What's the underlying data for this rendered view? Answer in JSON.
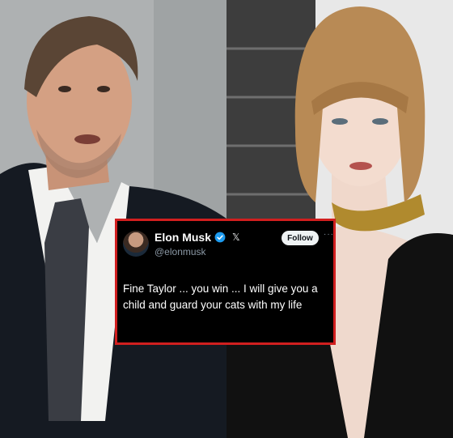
{
  "tweet": {
    "display_name": "Elon Musk",
    "handle": "@elonmusk",
    "follow_label": "Follow",
    "more_label": "···",
    "x_logo": "𝕏",
    "text": "Fine Taylor ... you win ... I will give you a child and guard your cats with my life"
  },
  "colors": {
    "card_background": "#000000",
    "card_border": "#d11f1f",
    "verified": "#1d9bf0",
    "follow_button": "#eff3f4"
  },
  "icons": {
    "verified": "verified-badge-icon",
    "x_logo": "x-logo-icon",
    "more": "more-icon"
  }
}
